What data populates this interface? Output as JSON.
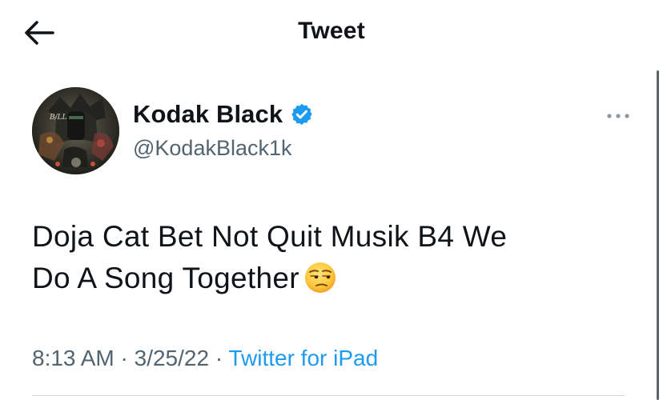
{
  "header": {
    "back_icon": "arrow-left-icon",
    "title": "Tweet"
  },
  "tweet": {
    "author": {
      "display_name": "Kodak Black",
      "handle": "@KodakBlack1k",
      "verified": true,
      "avatar_icon": "profile-photo",
      "verified_icon": "verified-badge-icon",
      "verified_color": "#1d9bf0"
    },
    "more_icon": "more-horizontal-icon",
    "text_line1": "Doja Cat Bet Not Quit Musik B4 We",
    "text_line2": "Do A Song Together",
    "emoji_icon": "unamused-face-emoji",
    "time": "8:13 AM",
    "date": "3/25/22",
    "separator": "·",
    "source": "Twitter for iPad",
    "colors": {
      "text": "#0f1419",
      "secondary": "#536471",
      "link": "#1d9bf0",
      "divider": "#cfd9de"
    }
  }
}
